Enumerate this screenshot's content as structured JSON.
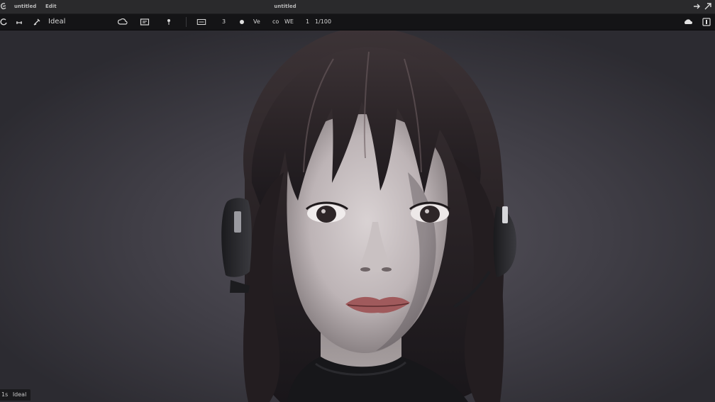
{
  "titlebar": {
    "menu_items": [
      "untitled",
      "Edit"
    ],
    "title": "untitled",
    "icons": [
      "app-logo-icon",
      "undo-arrow-icon",
      "redo-arrow-icon"
    ]
  },
  "toolbar": {
    "left_label": "Ideal",
    "frame_value": "3",
    "view_label": "Ve",
    "mode_label": "co",
    "zoom_label": "WE",
    "count_label": "1",
    "resolution_label": "1/100",
    "icons": [
      "refresh-icon",
      "measure-icon",
      "pen-icon",
      "cloud-icon",
      "panel-icon",
      "pin-icon",
      "frame-icon",
      "dot-icon",
      "cloud-status-icon",
      "export-icon"
    ]
  },
  "viewport": {
    "subject": "rendered portrait of girl with headphones",
    "background_color": "#3d3c43"
  },
  "status": {
    "prefix": "1s",
    "label": "Ideal"
  }
}
